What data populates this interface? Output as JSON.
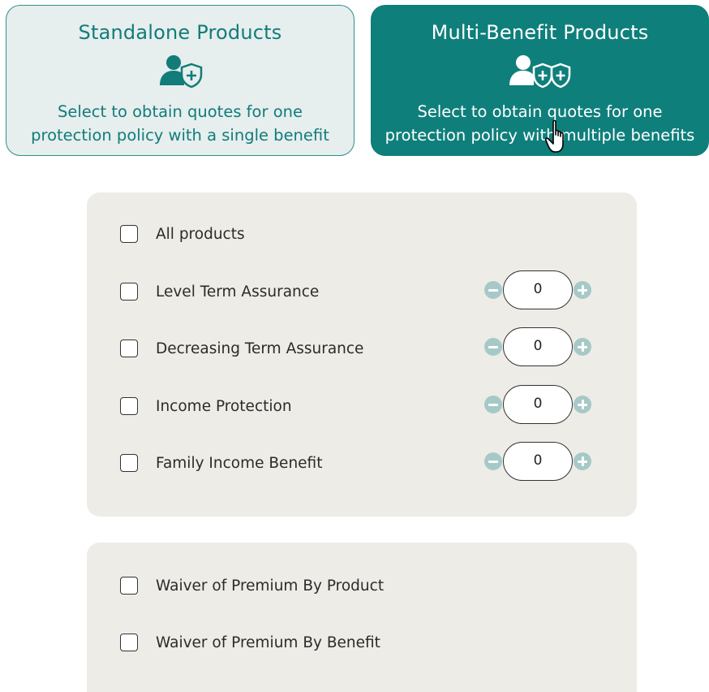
{
  "tiles": {
    "standalone": {
      "title": "Standalone Products",
      "line1": "Select to obtain quotes for one",
      "line2": "protection policy with a single benefit",
      "icon": "person-shield-icon"
    },
    "multi": {
      "title": "Multi-Benefit Products",
      "line1": "Select to obtain quotes for one",
      "line2": "protection policy with multiple benefits",
      "icon": "person-double-shield-icon"
    }
  },
  "products": {
    "all": {
      "label": "All products"
    },
    "items": [
      {
        "label": "Level Term Assurance",
        "count": "0"
      },
      {
        "label": "Decreasing Term Assurance",
        "count": "0"
      },
      {
        "label": "Income Protection",
        "count": "0"
      },
      {
        "label": "Family Income Benefit",
        "count": "0"
      }
    ]
  },
  "waiver": {
    "items": [
      {
        "label": "Waiver of Premium By Product"
      },
      {
        "label": "Waiver of Premium By Benefit"
      }
    ]
  },
  "colors": {
    "teal": "#0f7f7b",
    "teal_light_bg": "#e6eeee",
    "panel_bg": "#eeece6",
    "stepper_btn": "#a6c9c8"
  }
}
